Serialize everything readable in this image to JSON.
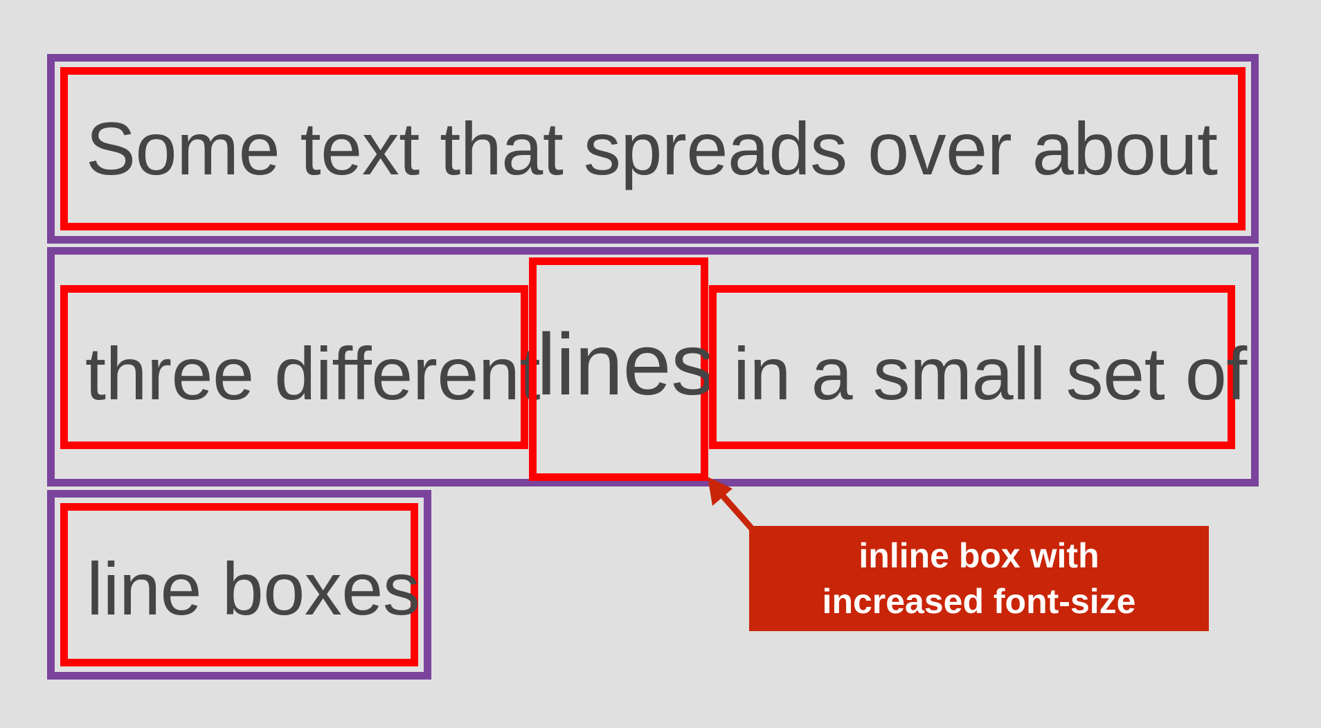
{
  "lines": [
    {
      "inline_boxes": [
        {
          "text": "Some text that spreads over about"
        }
      ]
    },
    {
      "inline_boxes": [
        {
          "text": "three different"
        },
        {
          "text": "lines",
          "increased_font_size": true
        },
        {
          "text": "in a small set of"
        }
      ]
    },
    {
      "inline_boxes": [
        {
          "text": "line boxes"
        }
      ]
    }
  ],
  "callout": {
    "line1": "inline box with",
    "line2": "increased font-size"
  },
  "colors": {
    "background": "#e0e0e0",
    "line_box_border": "#7a449c",
    "inline_box_border": "#ff0000",
    "text": "#454545",
    "callout_background": "#c92508",
    "callout_text": "#ffffff"
  }
}
